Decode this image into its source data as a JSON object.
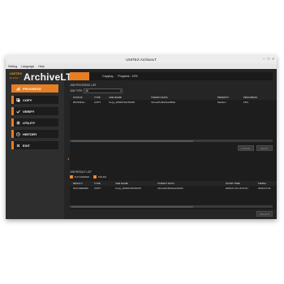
{
  "window": {
    "title": "UNITEX ArchiveLT",
    "controls": [
      "–",
      "□",
      "×"
    ]
  },
  "menu": [
    "Setting",
    "Language",
    "Help"
  ],
  "brand": {
    "vendor": "UNITEX",
    "tagline": "for Linux",
    "product": "ArchiveLT"
  },
  "nav": [
    {
      "label": "PROGRESS",
      "icon": "progress-icon",
      "active": true
    },
    {
      "label": "COPY",
      "icon": "copy-icon",
      "active": false
    },
    {
      "label": "VERIFY",
      "icon": "verify-icon",
      "active": false
    },
    {
      "label": "UTILITY",
      "icon": "utility-icon",
      "active": false
    },
    {
      "label": "HISTORY",
      "icon": "history-icon",
      "active": false
    },
    {
      "label": "EXIT",
      "icon": "exit-icon",
      "active": false
    }
  ],
  "status": {
    "text": "Copying...",
    "progress_label": "Progress : 19%",
    "progress": 0.19
  },
  "progress_list": {
    "title": "JOB PROGRESS LIST",
    "filter_label": "JOB TYPE",
    "filter_value": "All",
    "columns": [
      "STATUS",
      "TYPE",
      "JOB NAME",
      "TARGET DATA",
      "PRIORITY",
      "PROGRESS"
    ],
    "rows": [
      [
        "RUNNING...",
        "COPY",
        "Copy_20200722153452",
        "/home/Public/test/BKE",
        "Medium",
        "19%"
      ]
    ],
    "buttons": {
      "cancel": "CANCEL",
      "retry": "RETRY"
    }
  },
  "result_list": {
    "title": "JOB RESULT LIST",
    "filters": [
      {
        "label": "SUCCEEDED",
        "checked": true
      },
      {
        "label": "FAILED",
        "checked": true
      }
    ],
    "columns": [
      "RESULT",
      "TYPE",
      "JOB NAME",
      "TARGET DATA",
      "START TIME",
      "FINISH"
    ],
    "rows": [
      [
        "SUCCEEDED",
        "COPY",
        "Copy_20200722152437",
        "/home/Public/test/AAK0",
        "2020-07-22 15:24:37",
        "2020-07-22"
      ]
    ],
    "buttons": {
      "delete": "DELETE"
    }
  },
  "colors": {
    "accent": "#e67e22",
    "background": "#252525"
  }
}
